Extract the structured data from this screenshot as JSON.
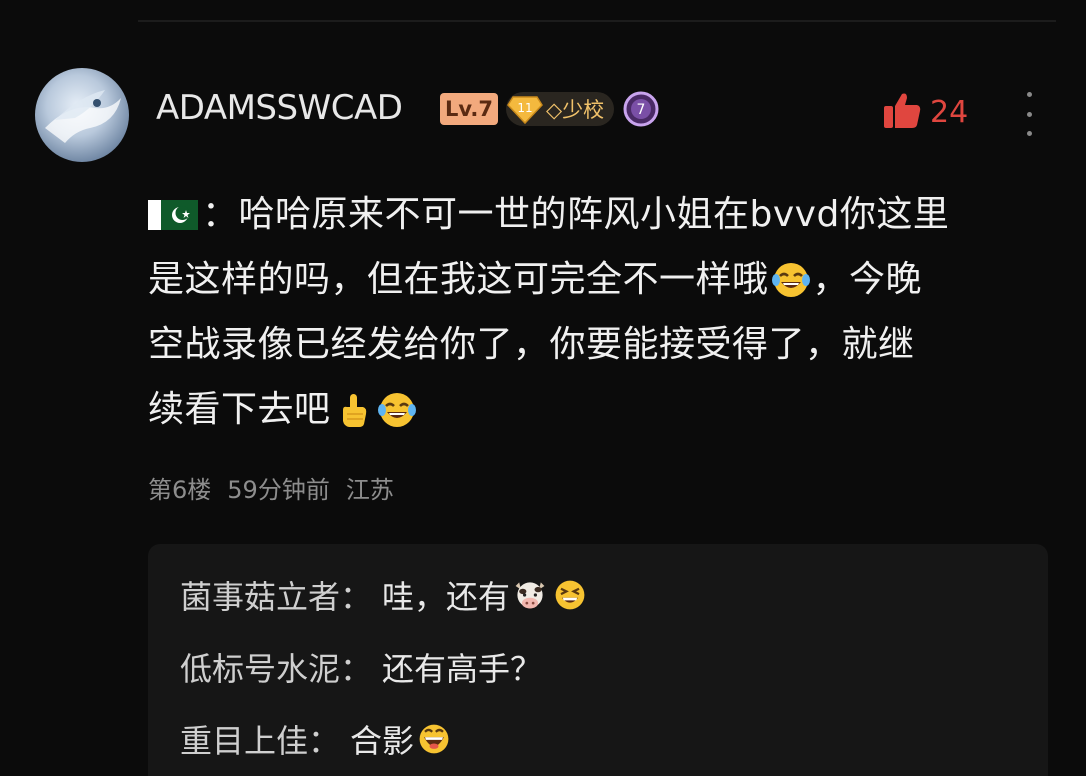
{
  "comment": {
    "username": "ADAMSSWCAD",
    "level_badge": "Lv.7",
    "fan_level": "11",
    "fan_rank": "◇少校",
    "vip_level": "7",
    "like_count": "24",
    "body_lines": [
      "：哈哈原来不可一世的阵风小姐在bvvd你这里",
      "是这样的吗，但在我这可完全不一样哦",
      "，今晚",
      "空战录像已经发给你了，你要能接受得了，就继",
      "续看下去吧"
    ],
    "meta": {
      "floor": "第6楼",
      "time": "59分钟前",
      "location": "江苏"
    }
  },
  "replies": [
    {
      "author": "菌事菇立者",
      "sep": "：",
      "text": "哇，还有"
    },
    {
      "author": "低标号水泥",
      "sep": "：",
      "text": "还有高手？"
    },
    {
      "author": "重目上佳",
      "sep": "：",
      "text": "合影"
    }
  ],
  "colors": {
    "background": "#0b0b0b",
    "like_red": "#e0463f",
    "level_badge": "#f2a97d",
    "fan_gold": "#f1c26a",
    "meta_gray": "#8d8d8d"
  },
  "icons": {
    "flag": "pakistan-flag-icon",
    "laugh": "tears-of-joy-icon",
    "point_up": "pointing-up-icon",
    "cow": "cow-face-icon",
    "grin": "grinning-squint-icon",
    "like": "thumbs-up-icon",
    "more": "more-vertical-icon"
  }
}
